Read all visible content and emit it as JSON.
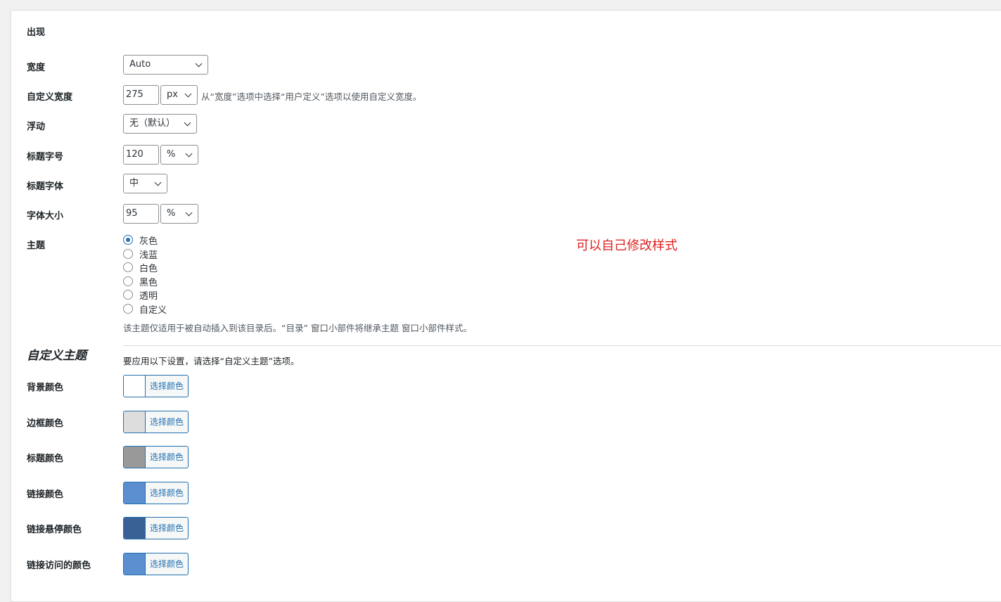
{
  "section": {
    "title": "出现"
  },
  "fields": {
    "width": {
      "label": "宽度",
      "value": "Auto"
    },
    "custom_width": {
      "label": "自定义宽度",
      "value": "275",
      "unit": "px",
      "help": "从“宽度”选项中选择“用户定义”选项以使用自定义宽度。"
    },
    "float": {
      "label": "浮动",
      "value": "无（默认）"
    },
    "title_font_size": {
      "label": "标题字号",
      "value": "120",
      "unit": "%"
    },
    "title_font_weight": {
      "label": "标题字体",
      "value": "中"
    },
    "font_size": {
      "label": "字体大小",
      "value": "95",
      "unit": "%"
    },
    "theme": {
      "label": "主题",
      "options": [
        "灰色",
        "浅蓝",
        "白色",
        "黑色",
        "透明",
        "自定义"
      ],
      "selected": "灰色",
      "help": "该主题仅适用于被自动插入到该目录后。“目录” 窗口小部件将继承主题 窗口小部件样式。"
    }
  },
  "annotation": {
    "text": "可以自己修改样式",
    "color": "#e02020"
  },
  "custom_theme": {
    "title": "自定义主题",
    "help": "要应用以下设置，请选择“自定义主题”选项。",
    "button_label": "选择颜色",
    "colors": [
      {
        "label": "背景颜色",
        "color": "#ffffff"
      },
      {
        "label": "边框颜色",
        "color": "#dddddd"
      },
      {
        "label": "标题颜色",
        "color": "#999999"
      },
      {
        "label": "链接颜色",
        "color": "#5b8fd0"
      },
      {
        "label": "链接悬停颜色",
        "color": "#3a6195"
      },
      {
        "label": "链接访问的颜色",
        "color": "#5b8fd0"
      }
    ]
  }
}
